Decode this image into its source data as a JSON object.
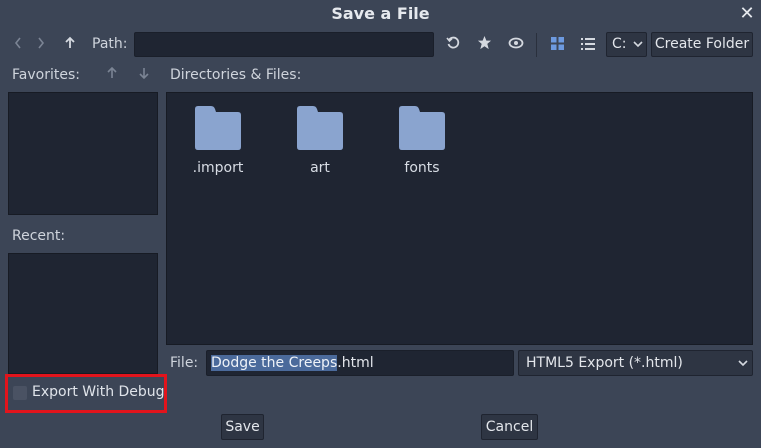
{
  "dialog": {
    "title": "Save a File"
  },
  "toolbar": {
    "path_label": "Path:",
    "path_value": "",
    "drive": "C:",
    "create_folder_label": "Create Folder"
  },
  "sidebar": {
    "favorites_label": "Favorites:",
    "recent_label": "Recent:"
  },
  "main": {
    "directories_label": "Directories & Files:",
    "items": [
      {
        "name": ".import",
        "icon": "folder-icon"
      },
      {
        "name": "art",
        "icon": "folder-icon"
      },
      {
        "name": "fonts",
        "icon": "folder-icon"
      }
    ]
  },
  "file": {
    "label": "File:",
    "name_selected": "Dodge the Creeps",
    "name_rest": ".html",
    "filter": "HTML5 Export (*.html)"
  },
  "options": {
    "export_with_debug_label": "Export With Debug",
    "export_with_debug_checked": false
  },
  "buttons": {
    "save": "Save",
    "cancel": "Cancel"
  },
  "colors": {
    "background": "#3c4556",
    "panel": "#1f2532",
    "folder": "#8aa4cf",
    "accent": "#6d9ae0",
    "highlight_border": "#e2141c"
  }
}
